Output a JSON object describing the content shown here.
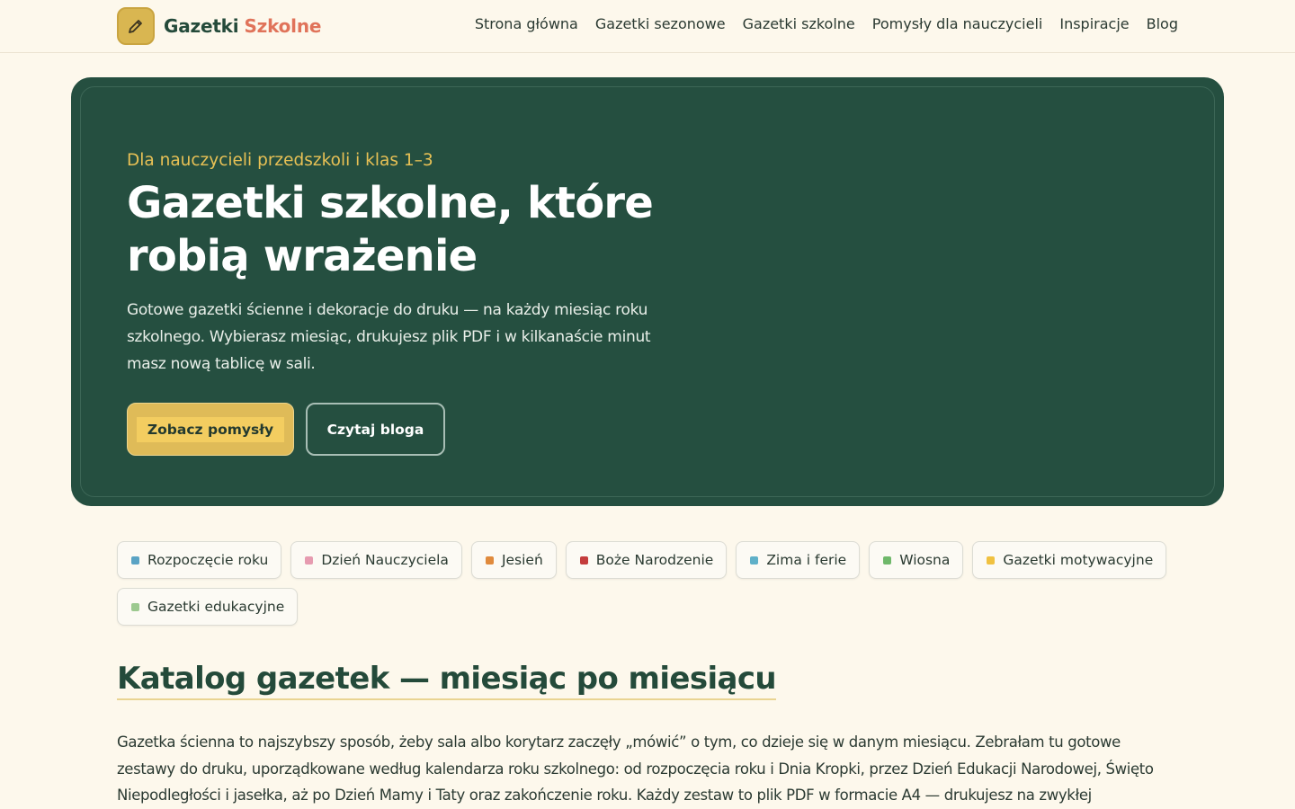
{
  "header": {
    "logo_word1": "Gazetki",
    "logo_word2": "Szkolne",
    "nav": [
      "Strona główna",
      "Gazetki sezonowe",
      "Gazetki szkolne",
      "Pomysły dla nauczycieli",
      "Inspiracje",
      "Blog"
    ]
  },
  "hero": {
    "eyebrow": "Dla nauczycieli przedszkoli i klas 1–3",
    "title": "Gazetki szkolne, które robią wrażenie",
    "description": "Gotowe gazetki ścienne i dekoracje do druku — na każdy miesiąc roku szkolnego. Wybierasz miesiąc, drukujesz plik PDF i w kilkanaście minut masz nową tablicę w sali.",
    "primary_button": "Zobacz pomysły",
    "secondary_button": "Czytaj bloga"
  },
  "chips": [
    {
      "label": "Rozpoczęcie roku",
      "color": "#5aa3c4"
    },
    {
      "label": "Dzień Nauczyciela",
      "color": "#e69bb0"
    },
    {
      "label": "Jesień",
      "color": "#e08a3c"
    },
    {
      "label": "Boże Narodzenie",
      "color": "#c43c3c"
    },
    {
      "label": "Zima i ferie",
      "color": "#5fb0c8"
    },
    {
      "label": "Wiosna",
      "color": "#6fb86a"
    },
    {
      "label": "Gazetki motywacyjne",
      "color": "#f0c140"
    },
    {
      "label": "Gazetki edukacyjne",
      "color": "#9cc98f"
    }
  ],
  "catalog": {
    "title": "Katalog gazetek — miesiąc po miesiącu",
    "text": "Gazetka ścienna to najszybszy sposób, żeby sala albo korytarz zaczęły „mówić” o tym, co dzieje się w danym miesiącu. Zebrałam tu gotowe zestawy do druku, uporządkowane według kalendarza roku szkolnego: od rozpoczęcia roku i Dnia Kropki, przez Dzień Edukacji Narodowej, Święto Niepodległości i jasełka, aż po Dzień Mamy i Taty oraz zakończenie roku. Każdy zestaw to plik PDF w formacie A4 — drukujesz na zwykłej"
  },
  "colors": {
    "background": "#fdf8ec",
    "hero": "#254f40",
    "accent": "#dfbb58",
    "brand_red": "#e0735a"
  },
  "icons": {
    "logo": "pencil-icon"
  }
}
